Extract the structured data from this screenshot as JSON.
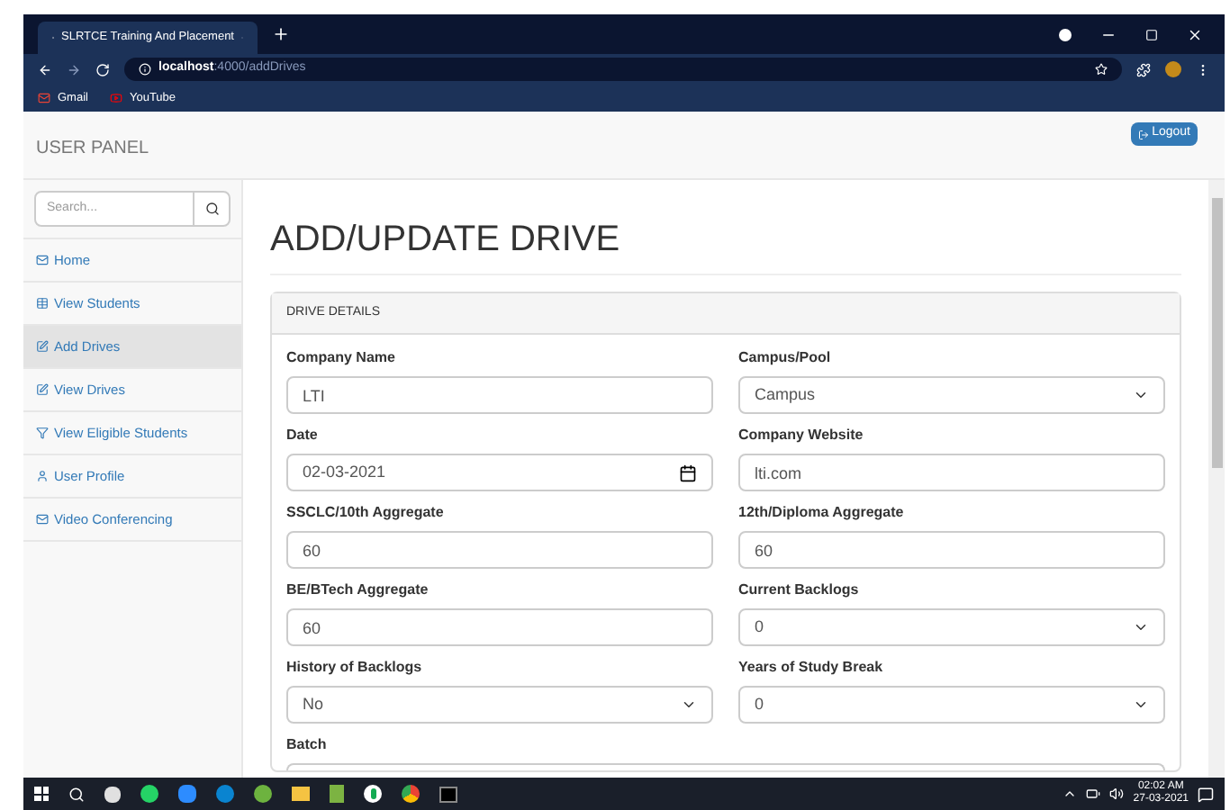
{
  "browser": {
    "tab_title": "SLRTCE Training And Placement",
    "url_host": "localhost",
    "url_path": ":4000/addDrives",
    "bookmarks": [
      "Gmail",
      "YouTube"
    ]
  },
  "header": {
    "brand": "USER PANEL",
    "logout": "Logout"
  },
  "sidebar": {
    "search_placeholder": "Search...",
    "items": [
      {
        "label": "Home",
        "selected": false
      },
      {
        "label": "View Students",
        "selected": false
      },
      {
        "label": "Add Drives",
        "selected": true
      },
      {
        "label": "View Drives",
        "selected": false
      },
      {
        "label": "View Eligible Students",
        "selected": false
      },
      {
        "label": "User Profile",
        "selected": false
      },
      {
        "label": "Video Conferencing",
        "selected": false
      }
    ]
  },
  "page_title": "ADD/UPDATE DRIVE",
  "panel": {
    "title": "DRIVE DETAILS",
    "fields": [
      {
        "label": "Company Name",
        "kind": "text",
        "value": "LTI"
      },
      {
        "label": "Campus/Pool",
        "kind": "select",
        "value": "Campus"
      },
      {
        "label": "Date",
        "kind": "date",
        "value": "02-03-2021"
      },
      {
        "label": "Company Website",
        "kind": "text",
        "value": "lti.com"
      },
      {
        "label": "SSCLC/10th Aggregate",
        "kind": "text",
        "value": "60"
      },
      {
        "label": "12th/Diploma Aggregate",
        "kind": "text",
        "value": "60"
      },
      {
        "label": "BE/BTech Aggregate",
        "kind": "text",
        "value": "60"
      },
      {
        "label": "Current Backlogs",
        "kind": "select",
        "value": "0"
      },
      {
        "label": "History of Backlogs",
        "kind": "select",
        "value": "No"
      },
      {
        "label": "Years of Study Break",
        "kind": "select",
        "value": "0"
      },
      {
        "label": "Batch",
        "kind": "partial"
      }
    ]
  },
  "taskbar": {
    "time": "02:02 AM",
    "date": "27-03-2021"
  }
}
